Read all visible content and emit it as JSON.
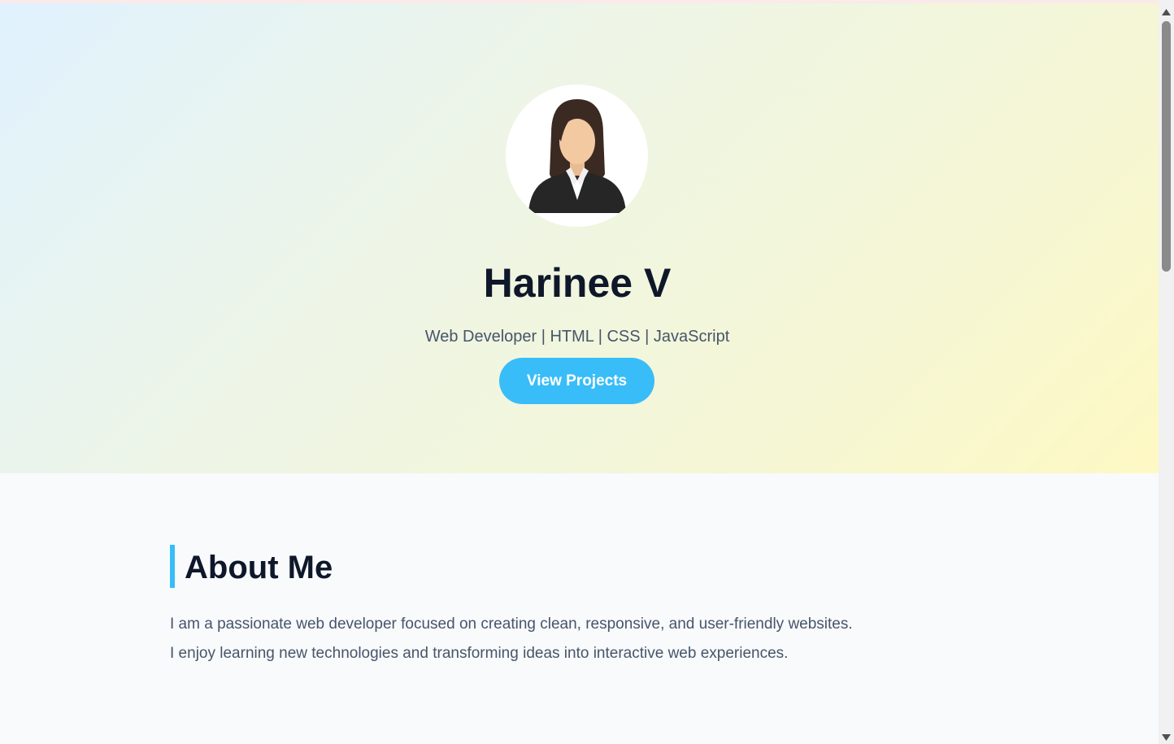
{
  "hero": {
    "name": "Harinee V",
    "tagline": "Web Developer | HTML | CSS | JavaScript",
    "button_label": "View Projects"
  },
  "about": {
    "title": "About Me",
    "lines": [
      "I am a passionate web developer focused on creating clean, responsive, and user-friendly websites.",
      "I enjoy learning new technologies and transforming ideas into interactive web experiences."
    ]
  },
  "colors": {
    "accent": "#38bdf8",
    "heading": "#0f172a",
    "body_text": "#475569",
    "page_bg": "#f8fafc"
  },
  "icons": {
    "avatar": "profile-avatar-icon",
    "scroll_up": "triangle-up-icon",
    "scroll_down": "triangle-down-icon"
  }
}
